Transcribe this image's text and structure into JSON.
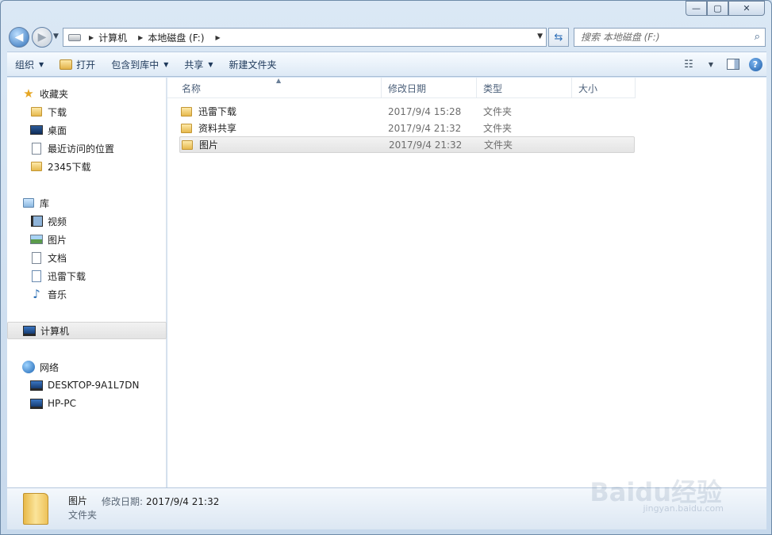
{
  "window": {
    "controls": {
      "minimize": "—",
      "maximize": "▢",
      "close": "✕"
    }
  },
  "navigation": {
    "back_icon": "back-arrow-icon",
    "forward_icon": "forward-arrow-icon",
    "breadcrumb": [
      "计算机",
      "本地磁盘 (F:)"
    ],
    "search_placeholder": "搜索 本地磁盘 (F:)"
  },
  "toolbar": {
    "organize": "组织",
    "open": "打开",
    "include_in_library": "包含到库中",
    "share": "共享",
    "new_folder": "新建文件夹"
  },
  "sidebar": {
    "favorites": {
      "label": "收藏夹",
      "items": [
        "下载",
        "桌面",
        "最近访问的位置",
        "2345下载"
      ]
    },
    "libraries": {
      "label": "库",
      "items": [
        "视频",
        "图片",
        "文档",
        "迅雷下载",
        "音乐"
      ]
    },
    "computer": {
      "label": "计算机"
    },
    "network": {
      "label": "网络",
      "items": [
        "DESKTOP-9A1L7DN",
        "HP-PC"
      ]
    }
  },
  "columns": {
    "name": "名称",
    "date": "修改日期",
    "type": "类型",
    "size": "大小"
  },
  "files": [
    {
      "name": "迅雷下载",
      "date": "2017/9/4 15:28",
      "type": "文件夹"
    },
    {
      "name": "资料共享",
      "date": "2017/9/4 21:32",
      "type": "文件夹"
    },
    {
      "name": "图片",
      "date": "2017/9/4 21:32",
      "type": "文件夹"
    }
  ],
  "details": {
    "name": "图片",
    "modified_label": "修改日期:",
    "modified_value": "2017/9/4 21:32",
    "type": "文件夹"
  },
  "watermark": {
    "logo": "Baidu经验",
    "url": "jingyan.baidu.com"
  }
}
